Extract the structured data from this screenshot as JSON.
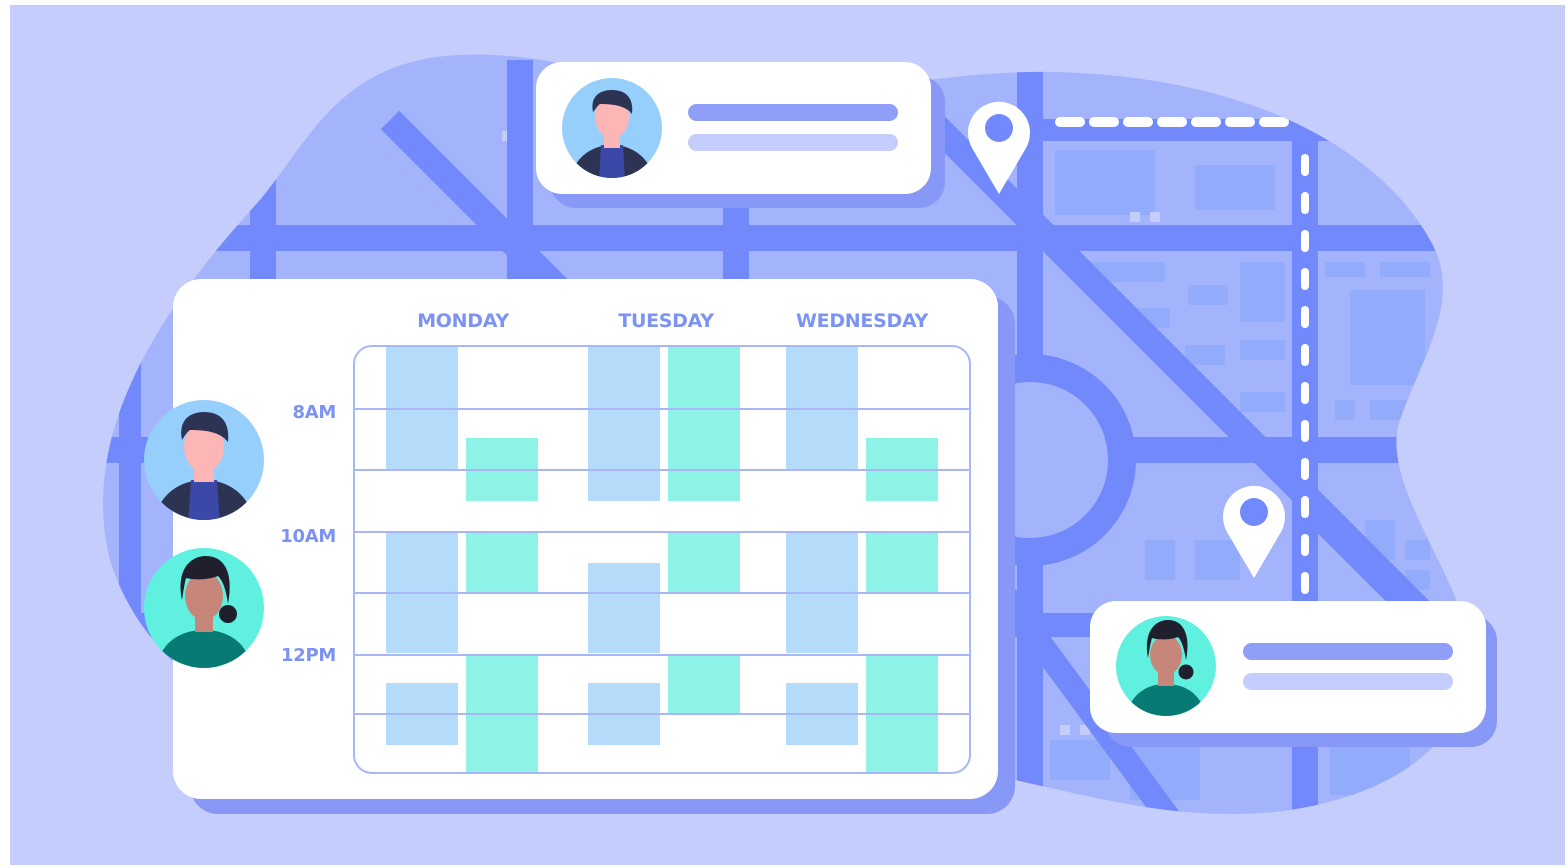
{
  "calendar": {
    "days": [
      "MONDAY",
      "TUESDAY",
      "WEDNESDAY"
    ],
    "times": [
      "8AM",
      "10AM",
      "12PM"
    ]
  },
  "colors": {
    "background": "#c5cdfd",
    "map_blob": "#a3b3fc",
    "road": "#7189fb",
    "card": "#ffffff",
    "card_shadow": "#8798f7",
    "label": "#7c93f3",
    "grid_line": "#a9b6f7",
    "event_blue": "#b5dbfa",
    "event_teal": "#8ef3e6",
    "avatar_blue": "#97cffc",
    "avatar_teal": "#5ff0e0"
  },
  "icons": [
    "map-pin-icon",
    "person-avatar-icon"
  ]
}
